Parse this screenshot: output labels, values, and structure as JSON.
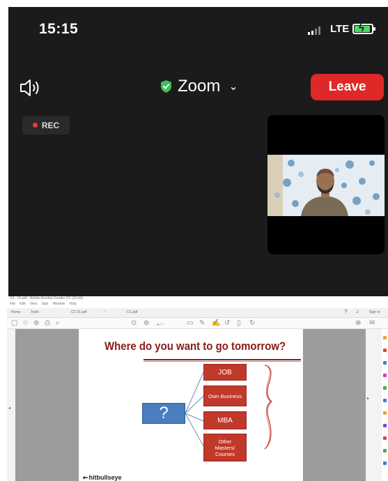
{
  "status_bar": {
    "time": "15:15",
    "network": "LTE",
    "battery_color": "#4cd964"
  },
  "zoom": {
    "meeting_title": "Zoom",
    "leave_label": "Leave",
    "leave_color": "#e02828",
    "recording_label": "REC",
    "icons": [
      "speaker-icon",
      "shield-check-icon",
      "chevron-down-icon"
    ]
  },
  "shared_screen": {
    "window_title": "C5 - 01.pdf - Adobe Acrobat Reader DC (32-bit)",
    "menu": [
      "File",
      "Edit",
      "View",
      "Sign",
      "Window",
      "Help"
    ],
    "tabs": [
      "Home",
      "Tools",
      "CC 01.pdf",
      "CC.pdf"
    ],
    "sign_in": "Sign In",
    "slide": {
      "title": "Where do you want to go tomorrow?",
      "question_mark": "?",
      "options": [
        "JOB",
        "Own Business",
        "MBA",
        "Other Masters/ Courses"
      ],
      "logo": "hitbullseye"
    }
  }
}
